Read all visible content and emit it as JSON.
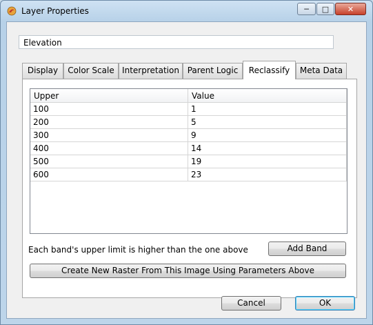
{
  "window": {
    "title": "Layer Properties",
    "icon": "app-icon",
    "controls": [
      "minimize",
      "maximize",
      "close"
    ]
  },
  "name_field": {
    "value": "Elevation"
  },
  "tabs": [
    {
      "label": "Display"
    },
    {
      "label": "Color Scale"
    },
    {
      "label": "Interpretation"
    },
    {
      "label": "Parent Logic"
    },
    {
      "label": "Reclassify",
      "active": true
    },
    {
      "label": "Meta Data"
    }
  ],
  "table": {
    "headers": [
      "Upper",
      "Value"
    ],
    "rows": [
      [
        "100",
        "1"
      ],
      [
        "200",
        "5"
      ],
      [
        "300",
        "9"
      ],
      [
        "400",
        "14"
      ],
      [
        "500",
        "19"
      ],
      [
        "600",
        "23"
      ]
    ]
  },
  "hint": "Each band's upper limit is higher than the one above",
  "buttons": {
    "add_band": "Add Band",
    "create_raster": "Create New Raster From This Image Using Parameters Above",
    "cancel": "Cancel",
    "ok": "OK"
  }
}
